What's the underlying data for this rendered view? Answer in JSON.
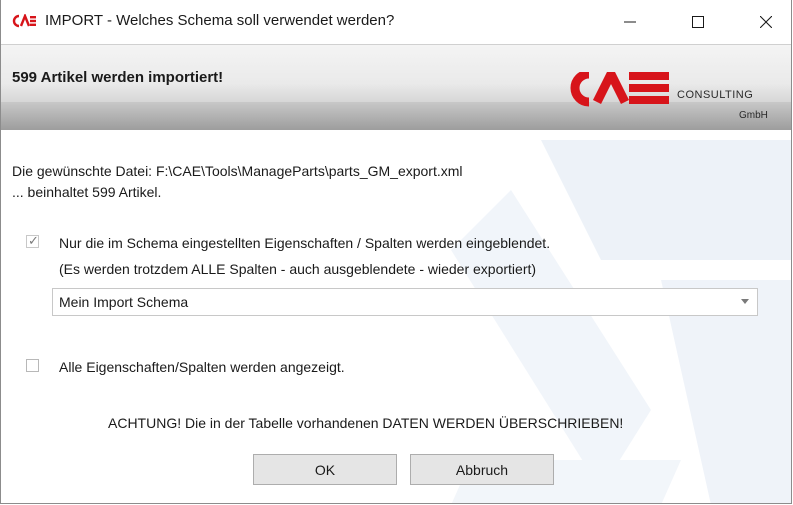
{
  "window": {
    "title": "IMPORT - Welches Schema soll verwendet werden?",
    "logo_icon": "cae-small-logo",
    "controls": [
      "minimize-icon",
      "maximize-icon",
      "close-icon"
    ]
  },
  "header": {
    "title": "599 Artikel werden importiert!",
    "brand_line1": "CONSULTING",
    "brand_line2": "GmbH",
    "brand_color": "#d7141a"
  },
  "info": {
    "file_line": "Die gewünschte Datei: F:\\CAE\\Tools\\ManageParts\\parts_GM_export.xml",
    "count_line": "... beinhaltet 599 Artikel."
  },
  "option_schema": {
    "checked": true,
    "label_line1": "Nur die im Schema eingestellten Eigenschaften / Spalten werden eingeblendet.",
    "label_line2": "(Es werden trotzdem ALLE Spalten - auch ausgeblendete - wieder exportiert)"
  },
  "schema_select": {
    "value": "Mein Import Schema"
  },
  "option_all": {
    "checked": false,
    "label": "Alle Eigenschaften/Spalten werden angezeigt."
  },
  "warning": "ACHTUNG! Die in der Tabelle vorhandenen DATEN WERDEN ÜBERSCHRIEBEN!",
  "buttons": {
    "ok": "OK",
    "cancel": "Abbruch"
  }
}
